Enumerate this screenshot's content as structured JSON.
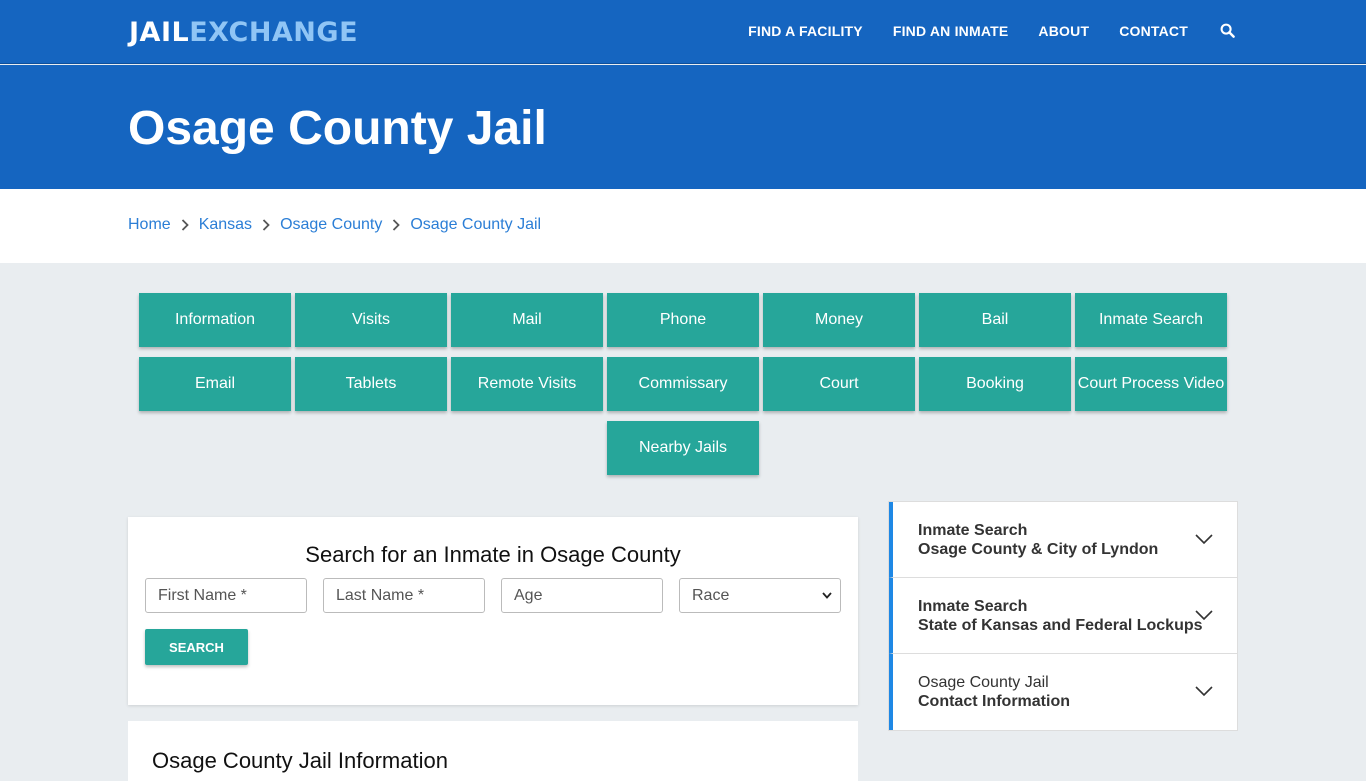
{
  "header": {
    "logo_part1": "JAIL",
    "logo_part2": "EXCHANGE",
    "nav": [
      "FIND A FACILITY",
      "FIND AN INMATE",
      "ABOUT",
      "CONTACT"
    ],
    "search_icon": "search-icon"
  },
  "hero": {
    "title": "Osage County Jail"
  },
  "breadcrumb": [
    "Home",
    "Kansas",
    "Osage County",
    "Osage County Jail"
  ],
  "buttons": [
    "Information",
    "Visits",
    "Mail",
    "Phone",
    "Money",
    "Bail",
    "Inmate Search",
    "Email",
    "Tablets",
    "Remote Visits",
    "Commissary",
    "Court",
    "Booking",
    "Court Process Video",
    "Nearby Jails"
  ],
  "search": {
    "title": "Search for an Inmate in Osage County",
    "first_name_placeholder": "First Name *",
    "last_name_placeholder": "Last Name *",
    "age_placeholder": "Age",
    "race_value": "Race",
    "button": "SEARCH"
  },
  "info": {
    "title": "Osage County Jail Information"
  },
  "accordion": [
    {
      "line1": "Inmate Search",
      "line2": "Osage County & City of Lyndon"
    },
    {
      "line1": "Inmate Search",
      "line2": "State of Kansas and Federal Lockups"
    },
    {
      "line1": "Osage County Jail",
      "line2": "Contact Information"
    }
  ],
  "colors": {
    "brand_blue": "#1565c0",
    "teal": "#26a69a",
    "link": "#2b7ed6"
  }
}
